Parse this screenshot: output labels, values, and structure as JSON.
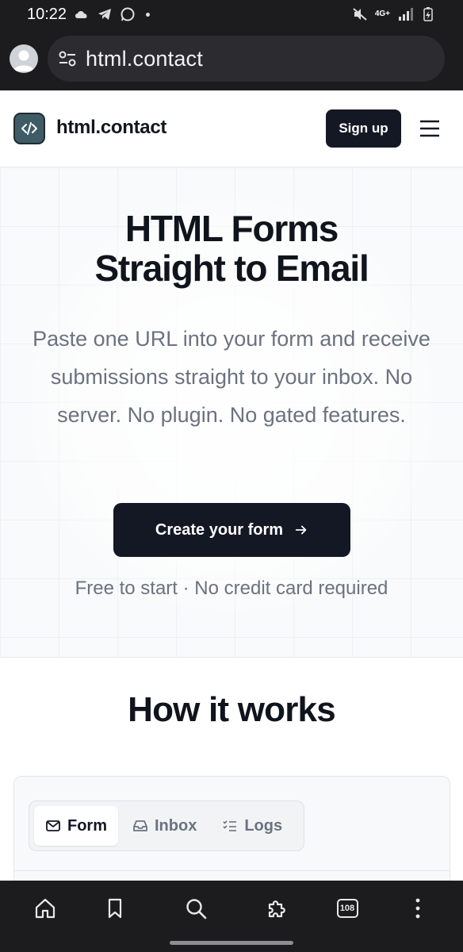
{
  "status_bar": {
    "time": "10:22",
    "network": "4G+"
  },
  "browser": {
    "url": "html.contact",
    "tab_count": "108"
  },
  "header": {
    "brand": "html.contact",
    "signup_label": "Sign up"
  },
  "hero": {
    "title_line1": "HTML Forms",
    "title_line2": "Straight to Email",
    "subtitle": "Paste one URL into your form and receive submissions straight to your inbox. No server. No plugin. No gated features.",
    "cta_label": "Create your form",
    "fine_print": "Free to start · No credit card required"
  },
  "how_it_works": {
    "title": "How it works",
    "tabs": [
      {
        "label": "Form",
        "icon": "mail-icon",
        "active": true
      },
      {
        "label": "Inbox",
        "icon": "inbox-icon",
        "active": false
      },
      {
        "label": "Logs",
        "icon": "list-check-icon",
        "active": false
      }
    ]
  },
  "colors": {
    "dark": "#141824",
    "muted": "#6b7280",
    "browser_chrome": "#1c1c1e"
  }
}
